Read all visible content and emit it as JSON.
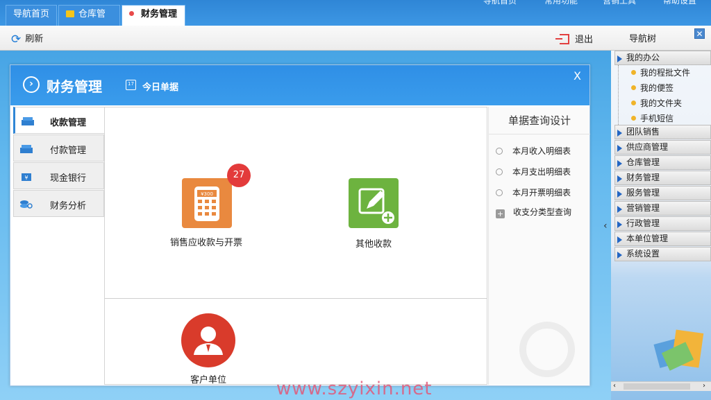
{
  "tabs": [
    {
      "label": "导航首页"
    },
    {
      "label": "仓库管理"
    },
    {
      "label": "财务管理"
    }
  ],
  "topnav": [
    "导航首页",
    "常用功能",
    "营销工具",
    "帮助设置"
  ],
  "toolbar": {
    "refresh": "刷新",
    "exit": "退出",
    "navtree": "导航树"
  },
  "dialog": {
    "title": "财务管理",
    "today": "今日单据",
    "close": "X",
    "cal_num": "17"
  },
  "left_menu": [
    {
      "label": "收款管理",
      "active": true
    },
    {
      "label": "付款管理"
    },
    {
      "label": "现金银行"
    },
    {
      "label": "财务分析"
    }
  ],
  "tiles": {
    "sales": {
      "label": "销售应收款与开票",
      "badge": "27",
      "screen_text": "¥300"
    },
    "other": {
      "label": "其他收款"
    },
    "customer": {
      "label": "客户单位"
    }
  },
  "query_panel": {
    "title": "单据查询设计",
    "items": [
      "本月收入明细表",
      "本月支出明细表",
      "本月开票明细表",
      "收支分类型查询"
    ]
  },
  "nav_tree": {
    "my_office": "我的办公",
    "my_office_items": [
      "我的程批文件",
      "我的便签",
      "我的文件夹",
      "手机短信"
    ],
    "groups": [
      "团队销售",
      "供应商管理",
      "仓库管理",
      "财务管理",
      "服务管理",
      "营销管理",
      "行政管理",
      "本单位管理",
      "系统设置"
    ]
  },
  "watermark": "www.szyixin.net",
  "colors": {
    "accent": "#2f8fe6",
    "badge": "#e33b3b",
    "orange_tile": "#e9893f",
    "green_tile": "#6db33f",
    "red_tile": "#d93b2b"
  }
}
